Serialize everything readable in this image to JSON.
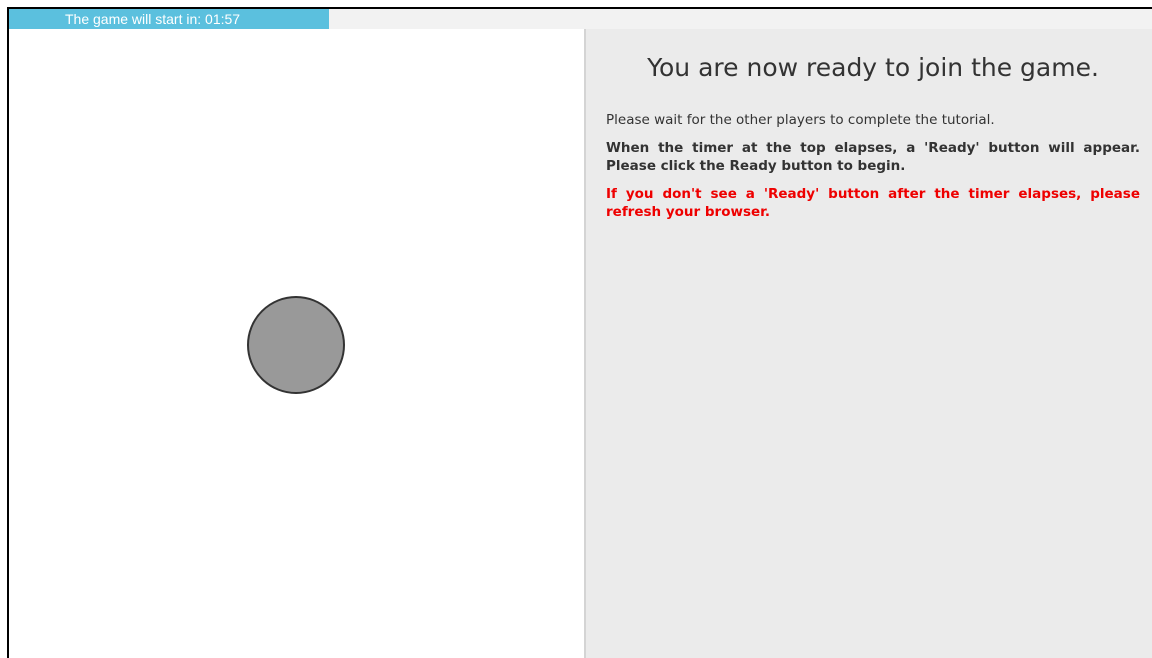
{
  "timer": {
    "label": "The game will start in: 01:57"
  },
  "game_area": {
    "player_color": "#999999"
  },
  "instructions": {
    "title": "You are now ready to join the game.",
    "wait_message": "Please wait for the other players to complete the tutorial.",
    "ready_message": "When the timer at the top elapses, a 'Ready' button will appear. Please click the Ready button to begin.",
    "refresh_warning": "If you don't see a 'Ready' button after the timer elapses, please refresh your browser.",
    "warning_color": "#ee0000"
  }
}
